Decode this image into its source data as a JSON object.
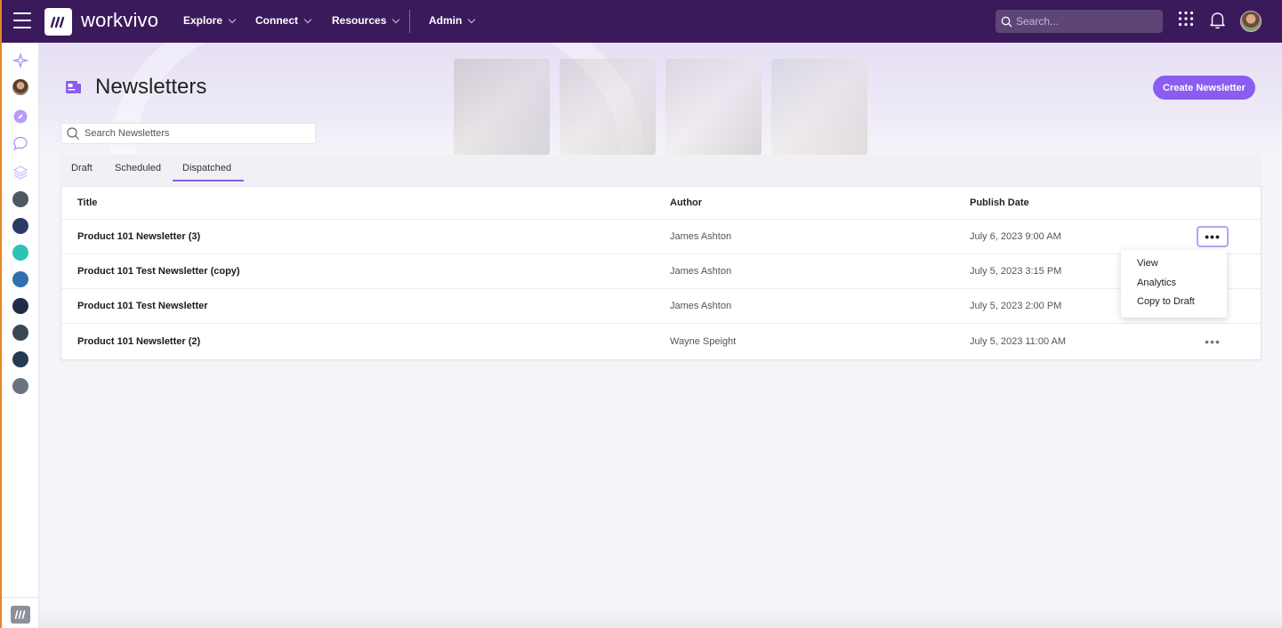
{
  "app": {
    "name": "workvivo"
  },
  "nav": {
    "items": [
      {
        "label": "Explore"
      },
      {
        "label": "Connect"
      },
      {
        "label": "Resources"
      },
      {
        "label": "Admin"
      }
    ]
  },
  "search_top": {
    "placeholder": "Search..."
  },
  "page": {
    "title": "Newsletters",
    "create_label": "Create Newsletter",
    "search_placeholder": "Search Newsletters"
  },
  "tabs": [
    {
      "label": "Draft"
    },
    {
      "label": "Scheduled"
    },
    {
      "label": "Dispatched",
      "active": true
    }
  ],
  "table": {
    "headers": {
      "title": "Title",
      "author": "Author",
      "date": "Publish Date"
    },
    "rows": [
      {
        "title": "Product 101 Newsletter (3)",
        "author": "James Ashton",
        "date": "July 6, 2023 9:00 AM"
      },
      {
        "title": "Product 101 Test Newsletter (copy)",
        "author": "James Ashton",
        "date": "July 5, 2023 3:15 PM"
      },
      {
        "title": "Product 101 Test Newsletter",
        "author": "James Ashton",
        "date": "July 5, 2023 2:00 PM"
      },
      {
        "title": "Product 101 Newsletter (2)",
        "author": "Wayne Speight",
        "date": "July 5, 2023 11:00 AM"
      }
    ],
    "more_label": "•••"
  },
  "menu": {
    "items": [
      {
        "label": "View"
      },
      {
        "label": "Analytics"
      },
      {
        "label": "Copy to Draft"
      }
    ]
  },
  "colors": {
    "topbar": "#3b1a5c",
    "accent": "#8b5cf0"
  }
}
